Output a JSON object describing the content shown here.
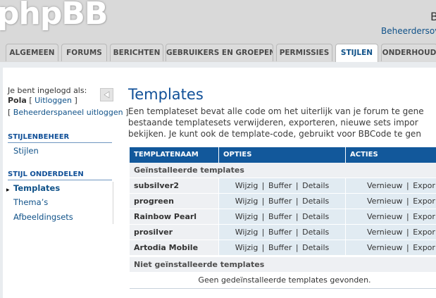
{
  "header": {
    "logo": "phpBB",
    "title": "B",
    "top_link": "Beheerdersov"
  },
  "tabs": [
    {
      "label": "ALGEMEEN",
      "active": false
    },
    {
      "label": "FORUMS",
      "active": false
    },
    {
      "label": "BERICHTEN",
      "active": false
    },
    {
      "label": "GEBRUIKERS EN GROEPEN",
      "active": false
    },
    {
      "label": "PERMISSIES",
      "active": false
    },
    {
      "label": "STIJLEN",
      "active": true
    },
    {
      "label": "ONDERHOUD",
      "active": false
    }
  ],
  "sidebar": {
    "login_text": "Je bent ingelogd als:",
    "username": "Pola",
    "logout_link": "Uitloggen",
    "admin_logout_link": "Beheerderspaneel uitloggen",
    "sections": [
      {
        "heading": "STIJLENBEHEER",
        "items": [
          {
            "label": "Stijlen",
            "active": false
          }
        ]
      },
      {
        "heading": "STIJL ONDERDELEN",
        "items": [
          {
            "label": "Templates",
            "active": true
          },
          {
            "label": "Thema’s",
            "active": false
          },
          {
            "label": "Afbeeldingsets",
            "active": false
          }
        ]
      }
    ]
  },
  "main": {
    "title": "Templates",
    "description_lines": [
      "Een templateset bevat alle code om het uiterlijk van je forum te gene",
      "bestaande templatesets verwijderen, exporteren, nieuwe sets impor",
      "bekijken. Je kunt ook de template-code, gebruikt voor BBCode te gen"
    ],
    "table": {
      "columns": [
        "TEMPLATENAAM",
        "OPTIES",
        "ACTIES"
      ],
      "installed_heading": "Geïnstalleerde templates",
      "rows": [
        {
          "name": "subsilver2",
          "options": [
            "Wijzig",
            "Buffer",
            "Details"
          ],
          "actions": [
            "Vernieuw",
            "Expor"
          ]
        },
        {
          "name": "progreen",
          "options": [
            "Wijzig",
            "Buffer",
            "Details"
          ],
          "actions": [
            "Vernieuw",
            "Expor"
          ]
        },
        {
          "name": "Rainbow Pearl",
          "options": [
            "Wijzig",
            "Buffer",
            "Details"
          ],
          "actions": [
            "Vernieuw",
            "Expor"
          ]
        },
        {
          "name": "prosilver",
          "options": [
            "Wijzig",
            "Buffer",
            "Details"
          ],
          "actions": [
            "Vernieuw",
            "Expor"
          ]
        },
        {
          "name": "Artodia Mobile",
          "options": [
            "Wijzig",
            "Buffer",
            "Details"
          ],
          "actions": [
            "Vernieuw",
            "Expor"
          ]
        }
      ],
      "uninstalled_heading": "Niet geïnstalleerde templates",
      "empty_message": "Geen gedeïnstalleerde templates gevonden."
    }
  },
  "colors": {
    "accent": "#105289",
    "table_header": "#12589b",
    "row_bg": "#e1ebf2",
    "section_bg": "#eef0f3"
  }
}
